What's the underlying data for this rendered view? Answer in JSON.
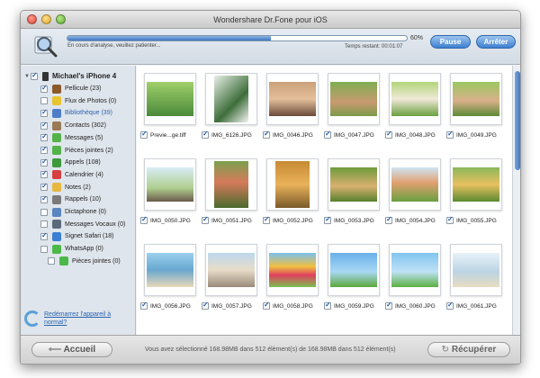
{
  "window": {
    "title": "Wondershare Dr.Fone pour iOS"
  },
  "toolbar": {
    "status": "En cours d'analyse, veuillez patienter...",
    "progress": 0.6,
    "percent": "60%",
    "remaining": "Temps restant:  00:01:07",
    "pause": "Pause",
    "stop": "Arrêter"
  },
  "sidebar": {
    "device": "Michael's iPhone 4",
    "items": [
      {
        "label": "Pellicule (23)",
        "checked": true,
        "color": "#8b5a2b",
        "icon": "camera-roll-icon"
      },
      {
        "label": "Flux de Photos (0)",
        "checked": false,
        "color": "#e8c431",
        "icon": "photo-stream-icon"
      },
      {
        "label": "Bibliothèque (39)",
        "checked": true,
        "color": "#4c7fc8",
        "icon": "photo-library-icon",
        "highlight": true
      },
      {
        "label": "Contacts (302)",
        "checked": true,
        "color": "#9a7a56",
        "icon": "contacts-icon"
      },
      {
        "label": "Messages (5)",
        "checked": true,
        "color": "#52b34a",
        "icon": "messages-icon"
      },
      {
        "label": "Pièces jointes (2)",
        "checked": true,
        "color": "#52b34a",
        "icon": "attachment-icon"
      },
      {
        "label": "Appels (108)",
        "checked": true,
        "color": "#3c9a3c",
        "icon": "phone-icon"
      },
      {
        "label": "Calendrier (4)",
        "checked": true,
        "color": "#d64040",
        "icon": "calendar-icon"
      },
      {
        "label": "Notes (2)",
        "checked": true,
        "color": "#e6b840",
        "icon": "notes-icon"
      },
      {
        "label": "Rappels (10)",
        "checked": true,
        "color": "#7a7a7a",
        "icon": "reminders-icon"
      },
      {
        "label": "Dictaphone (0)",
        "checked": false,
        "color": "#5a86c0",
        "icon": "voice-memo-icon"
      },
      {
        "label": "Messages Vocaux (0)",
        "checked": false,
        "color": "#5a6a7a",
        "icon": "voicemail-icon"
      },
      {
        "label": "Signet Safari (18)",
        "checked": true,
        "color": "#3b7fd4",
        "icon": "safari-icon"
      },
      {
        "label": "WhatsApp (0)",
        "checked": false,
        "color": "#4cb848",
        "icon": "whatsapp-icon"
      },
      {
        "label": "Pièces jointes (0)",
        "checked": false,
        "color": "#4cb848",
        "icon": "whatsapp-attachment-icon",
        "indent": true
      }
    ],
    "restart": "Redémarrez l'appareil à normal?"
  },
  "grid": [
    {
      "name": "Previe...ge.tiff",
      "bg": "linear-gradient(#9fcf6a,#4a8a3a)",
      "portrait": false
    },
    {
      "name": "IMG_6126.JPG",
      "bg": "linear-gradient(135deg,#e8efe6,#3d6e3a 60%,#f5f5f5)",
      "portrait": true
    },
    {
      "name": "IMG_0046.JPG",
      "bg": "linear-gradient(#c9a07a,#e4c09a 50%,#6a4a3a)",
      "portrait": false
    },
    {
      "name": "IMG_0047.JPG",
      "bg": "linear-gradient(#7fae52,#c89a70 60%,#7a9a4a)",
      "portrait": false
    },
    {
      "name": "IMG_0048.JPG",
      "bg": "linear-gradient(#b2d67a,#f0e8d8 50%,#6aa040)",
      "portrait": false
    },
    {
      "name": "IMG_0049.JPG",
      "bg": "linear-gradient(#9bc760,#d9b08a 55%,#5c8a36)",
      "portrait": false
    },
    {
      "name": "IMG_0050.JPG",
      "bg": "linear-gradient(#d8ecf6,#b0cf90 60%,#6a5a4a)",
      "portrait": false
    },
    {
      "name": "IMG_0051.JPG",
      "bg": "linear-gradient(#7aa04e,#d67a5a 45%,#4a6a2e)",
      "portrait": true
    },
    {
      "name": "IMG_0052.JPG",
      "bg": "linear-gradient(#c78a34,#e9b25a 50%,#7a5a2a)",
      "portrait": true
    },
    {
      "name": "IMG_0053.JPG",
      "bg": "linear-gradient(#6e9a3c,#d8b070 55%,#56802c)",
      "portrait": false
    },
    {
      "name": "IMG_0054.JPG",
      "bg": "linear-gradient(#cfe4f4,#e0a070 45%,#6aa040)",
      "portrait": false
    },
    {
      "name": "IMG_0055.JPG",
      "bg": "linear-gradient(#8ab85a,#e8c060 50%,#5a8a30)",
      "portrait": false
    },
    {
      "name": "IMG_0056.JPG",
      "bg": "linear-gradient(#9ad0ee,#6aa8d0 50%,#e8d8b8)",
      "portrait": false
    },
    {
      "name": "IMG_0057.JPG",
      "bg": "linear-gradient(#bcd8ee,#e8dcc8 50%,#9a8a7a)",
      "portrait": false
    },
    {
      "name": "IMG_0058.JPG",
      "bg": "linear-gradient(#7ac0f0,#f0c040 40%,#e04060 65%,#7ac050)",
      "portrait": false
    },
    {
      "name": "IMG_0059.JPG",
      "bg": "linear-gradient(#6ab0ea,#a8d8f4 55%,#5aa83a)",
      "portrait": false
    },
    {
      "name": "IMG_0060.JPG",
      "bg": "linear-gradient(#80c4f0,#bfe2f6 55%,#5ab040)",
      "portrait": false
    },
    {
      "name": "IMG_0061.JPG",
      "bg": "linear-gradient(#e8f2f8,#bcd4e4 55%,#e8dcc0)",
      "portrait": false
    }
  ],
  "footer": {
    "home": "Accueil",
    "selection": "Vous avez sélectionné 168.98MB dans 512 élément(s) de 168.98MB dans 512 élément(s)",
    "recover": "Récupérer"
  }
}
